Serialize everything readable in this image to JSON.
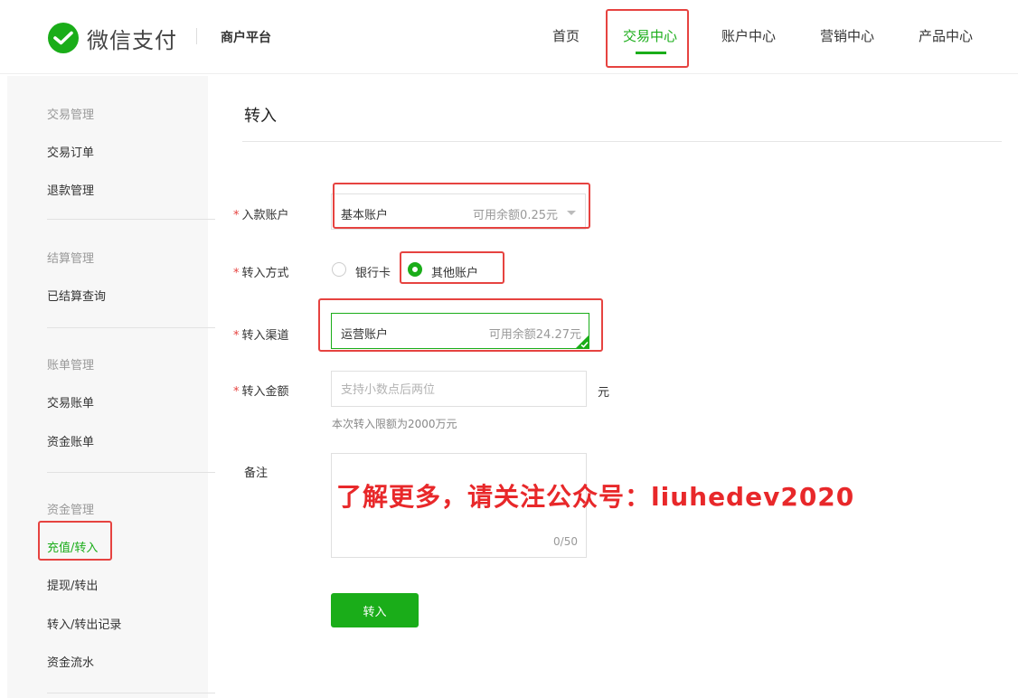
{
  "header": {
    "brand": "微信支付",
    "platform": "商户平台",
    "nav": [
      {
        "label": "首页",
        "active": false
      },
      {
        "label": "交易中心",
        "active": true
      },
      {
        "label": "账户中心",
        "active": false
      },
      {
        "label": "营销中心",
        "active": false
      },
      {
        "label": "产品中心",
        "active": false
      }
    ]
  },
  "sidebar": {
    "groups": [
      {
        "title": "交易管理",
        "items": [
          "交易订单",
          "退款管理"
        ]
      },
      {
        "title": "结算管理",
        "items": [
          "已结算查询"
        ]
      },
      {
        "title": "账单管理",
        "items": [
          "交易账单",
          "资金账单"
        ]
      },
      {
        "title": "资金管理",
        "items": [
          "充值/转入",
          "提现/转出",
          "转入/转出记录",
          "资金流水"
        ]
      }
    ],
    "active_item": "充值/转入"
  },
  "main": {
    "title": "转入",
    "form": {
      "account": {
        "required_mark": "*",
        "label": "入款账户",
        "value": "基本账户",
        "balance": "可用余额0.25元"
      },
      "method": {
        "required_mark": "*",
        "label": "转入方式",
        "options": [
          "银行卡",
          "其他账户"
        ],
        "selected": "其他账户"
      },
      "channel": {
        "required_mark": "*",
        "label": "转入渠道",
        "value": "运营账户",
        "balance": "可用余额24.27元"
      },
      "amount": {
        "required_mark": "*",
        "label": "转入金额",
        "placeholder": "支持小数点后两位",
        "unit": "元",
        "hint": "本次转入限额为2000万元"
      },
      "remark": {
        "label": "备注",
        "counter": "0/50"
      },
      "submit_label": "转入"
    }
  },
  "overlay": {
    "watermark": "了解更多，请关注公众号：liuhedev2020"
  },
  "colors": {
    "accent": "#1aad19",
    "highlight": "#e64340",
    "watermark": "#e8282a"
  }
}
